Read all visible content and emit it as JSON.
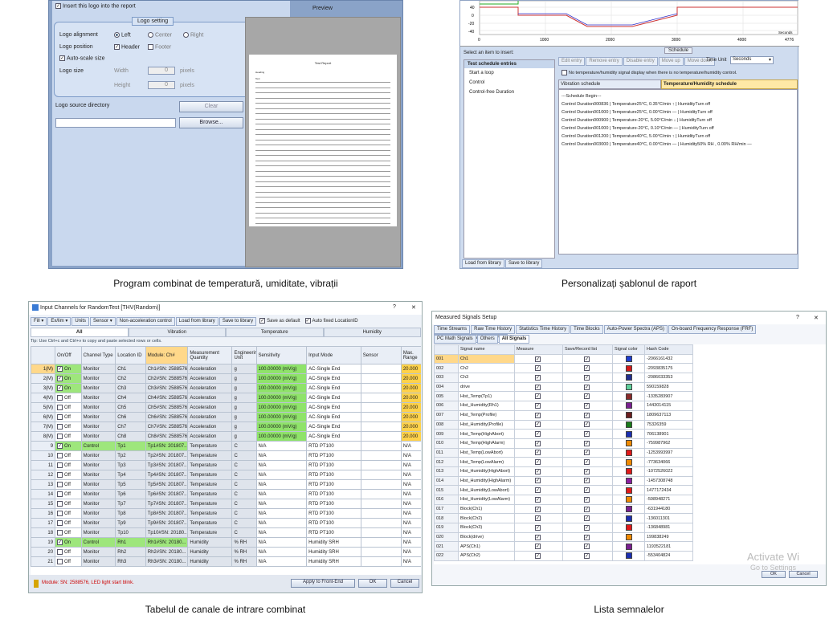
{
  "captions": {
    "p1": "Program combinat de temperatură, umiditate, vibrații",
    "p2": "Personalizați șablonul de raport",
    "p3": "Tabelul de canale de intrare combinat",
    "p4": "Lista semnalelor"
  },
  "logo": {
    "insert_label": "Insert this logo into the report",
    "preview_label": "Preview",
    "group_title": "Logo setting",
    "alignment_label": "Logo alignment",
    "align_left": "Left",
    "align_center": "Center",
    "align_right": "Right",
    "position_label": "Logo position",
    "pos_header": "Header",
    "pos_footer": "Footer",
    "autoscale_label": "Auto-scale size",
    "size_label": "Logo size",
    "width_label": "Width",
    "height_label": "Height",
    "width_value": "0",
    "height_value": "0",
    "pixels": "pixels",
    "source_label": "Logo source directory",
    "clear_btn": "Clear",
    "browse_btn": "Browse...",
    "doc_title": "Test Report",
    "doc_line1": "Heading",
    "doc_line2": "Text"
  },
  "schedule": {
    "y_ticks": [
      "40",
      "0",
      "-20",
      "-40"
    ],
    "x_ticks": [
      "0",
      "1000",
      "2000",
      "3000",
      "4000",
      "4776"
    ],
    "x_unit": "Seconds",
    "schedule_tab": "Schedule",
    "select_label": "Select an item to insert:",
    "list_header": "Test schedule entries",
    "list_items": [
      "Start a loop",
      "Control",
      "Control-free Duration"
    ],
    "toolbar": [
      "Edit entry",
      "Remove entry",
      "Disable entry",
      "Move up",
      "Move down"
    ],
    "time_unit_label": "Time Unit",
    "time_unit_value": "Seconds",
    "no_display_label": "No temperature/humidity signal display when there is no temperature/humidity control.",
    "tabs": [
      "Vibration schedule",
      "Temperature/Humidity schedule"
    ],
    "lines": [
      "---Schedule Begin---",
      "Control Duration000836 | Temperature25°C, 0.35°C/min ↑ | HumidityTurn off",
      "Control Duration001000 | Temperature25°C, 0.00°C/min — | HumidityTurn off",
      "Control Duration000900 | Temperature-20°C, 5.00°C/min ↓ | HumidityTurn off",
      "Control Duration001000 | Temperature-20°C, 0.10°C/min — | HumidityTurn off",
      "Control Duration001200 | Temperature40°C, 5.00°C/min ↑ | HumidityTurn off",
      "Control Duration003000 | Temperature40°C, 0.00°C/min — | Humidity50% RH , 0.00% RH/min —"
    ],
    "bottom_btns": [
      "Load from library",
      "Save to library"
    ]
  },
  "channels": {
    "title": "Input Channels for  RandomTest [THV(Random)]",
    "help": "?",
    "close": "✕",
    "toolbar": [
      "Fill ▾",
      "Ex/lim ▾",
      "Units",
      "Sensor ▾",
      "Non-acceleration control",
      "Load from library",
      "Save to library"
    ],
    "save_default": "Save as default",
    "auto_fixed": "Auto fixed LocationID",
    "tabs": [
      "All",
      "Vibration",
      "Temperature",
      "Humidity"
    ],
    "tip": "Tip: Use Ctrl+c and Ctrl+v to copy and paste selected rows or cells.",
    "headers": [
      "",
      "On/Off",
      "Channel Type",
      "Location ID",
      "Module: Ch#",
      "Measurement Quantity",
      "Engineering Unit",
      "Sensitivity",
      "Input Mode",
      "Sensor",
      "Max. Range"
    ],
    "rows": [
      [
        "1(M)",
        "On",
        "Monitor",
        "Ch1",
        "Ch1#SN: 2588576",
        "Acceleration",
        "g",
        "100.00000 (mV/g)",
        "AC-Single End",
        "",
        "20.000"
      ],
      [
        "2(M)",
        "On",
        "Monitor",
        "Ch2",
        "Ch2#SN: 2588576",
        "Acceleration",
        "g",
        "100.00000 (mV/g)",
        "AC-Single End",
        "",
        "20.000"
      ],
      [
        "3(M)",
        "On",
        "Monitor",
        "Ch3",
        "Ch3#SN: 2588576",
        "Acceleration",
        "g",
        "100.00000 (mV/g)",
        "AC-Single End",
        "",
        "20.000"
      ],
      [
        "4(M)",
        "Off",
        "Monitor",
        "Ch4",
        "Ch4#SN: 2588576",
        "Acceleration",
        "g",
        "100.00000 (mV/g)",
        "AC-Single End",
        "",
        "20.000"
      ],
      [
        "5(M)",
        "Off",
        "Monitor",
        "Ch5",
        "Ch5#SN: 2588576",
        "Acceleration",
        "g",
        "100.00000 (mV/g)",
        "AC-Single End",
        "",
        "20.000"
      ],
      [
        "6(M)",
        "Off",
        "Monitor",
        "Ch6",
        "Ch6#SN: 2588576",
        "Acceleration",
        "g",
        "100.00000 (mV/g)",
        "AC-Single End",
        "",
        "20.000"
      ],
      [
        "7(M)",
        "Off",
        "Monitor",
        "Ch7",
        "Ch7#SN: 2588576",
        "Acceleration",
        "g",
        "100.00000 (mV/g)",
        "AC-Single End",
        "",
        "20.000"
      ],
      [
        "8(M)",
        "Off",
        "Monitor",
        "Ch8",
        "Ch8#SN: 2588576",
        "Acceleration",
        "g",
        "100.00000 (mV/g)",
        "AC-Single End",
        "",
        "20.000"
      ],
      [
        "9",
        "On",
        "Control",
        "Tp1",
        "Tp1#SN: 201807...",
        "Temperature",
        "C",
        "N/A",
        "RTD PT100",
        "",
        "N/A"
      ],
      [
        "10",
        "Off",
        "Monitor",
        "Tp2",
        "Tp2#SN: 201807...",
        "Temperature",
        "C",
        "N/A",
        "RTD PT100",
        "",
        "N/A"
      ],
      [
        "11",
        "Off",
        "Monitor",
        "Tp3",
        "Tp3#SN: 201807...",
        "Temperature",
        "C",
        "N/A",
        "RTD PT100",
        "",
        "N/A"
      ],
      [
        "12",
        "Off",
        "Monitor",
        "Tp4",
        "Tp4#SN: 201807...",
        "Temperature",
        "C",
        "N/A",
        "RTD PT100",
        "",
        "N/A"
      ],
      [
        "13",
        "Off",
        "Monitor",
        "Tp5",
        "Tp5#SN: 201807...",
        "Temperature",
        "C",
        "N/A",
        "RTD PT100",
        "",
        "N/A"
      ],
      [
        "14",
        "Off",
        "Monitor",
        "Tp6",
        "Tp6#SN: 201807...",
        "Temperature",
        "C",
        "N/A",
        "RTD PT100",
        "",
        "N/A"
      ],
      [
        "15",
        "Off",
        "Monitor",
        "Tp7",
        "Tp7#SN: 201807...",
        "Temperature",
        "C",
        "N/A",
        "RTD PT100",
        "",
        "N/A"
      ],
      [
        "16",
        "Off",
        "Monitor",
        "Tp8",
        "Tp8#SN: 201807...",
        "Temperature",
        "C",
        "N/A",
        "RTD PT100",
        "",
        "N/A"
      ],
      [
        "17",
        "Off",
        "Monitor",
        "Tp9",
        "Tp9#SN: 201807...",
        "Temperature",
        "C",
        "N/A",
        "RTD PT100",
        "",
        "N/A"
      ],
      [
        "18",
        "Off",
        "Monitor",
        "Tp10",
        "Tp10#SN: 20180...",
        "Temperature",
        "C",
        "N/A",
        "RTD PT100",
        "",
        "N/A"
      ],
      [
        "19",
        "On",
        "Control",
        "Rh1",
        "Rh1#SN: 20180...",
        "Humidity",
        "% RH",
        "N/A",
        "Humidity SRH",
        "",
        "N/A"
      ],
      [
        "20",
        "Off",
        "Monitor",
        "Rh2",
        "Rh2#SN: 20180...",
        "Humidity",
        "% RH",
        "N/A",
        "Humidity SRH",
        "",
        "N/A"
      ],
      [
        "21",
        "Off",
        "Monitor",
        "Rh3",
        "Rh3#SN: 20180...",
        "Humidity",
        "% RH",
        "N/A",
        "Humidity SRH",
        "",
        "N/A"
      ]
    ],
    "status": "Module: SN: 2588576, LED light start blink.",
    "apply_btn": "Apply to Front-End",
    "ok_btn": "OK",
    "cancel_btn": "Cancel"
  },
  "signals": {
    "title": "Measured Signals Setup",
    "help": "?",
    "close": "✕",
    "tabs_row1": [
      "Time Streams",
      "Raw Time History",
      "Statistics Time History",
      "Time Blocks",
      "Auto-Power Spectra (APS)",
      "On-board Frequency Response (FRF)",
      "PC Frequency Response (FRF)"
    ],
    "tabs_row2": [
      "PC Math Signals",
      "Others",
      "All Signals"
    ],
    "headers": [
      "",
      "Signal name",
      "Measure",
      "Save/Record list",
      "Signal color",
      "Hash Code"
    ],
    "rows": [
      [
        "001",
        "Ch1",
        "#1f3fd0",
        "-2066161432"
      ],
      [
        "002",
        "Ch2",
        "#d21a1a",
        "-2093835175"
      ],
      [
        "003",
        "Ch3",
        "#23308f",
        "-2086033353"
      ],
      [
        "004",
        "drive",
        "#5fcf9b",
        "590159828"
      ],
      [
        "005",
        "Hist_Temp(Tp1)",
        "#8a2b2b",
        "-1335283907"
      ],
      [
        "006",
        "Hist_Humidity(Rh1)",
        "#7a2090",
        "1443014115"
      ],
      [
        "007",
        "Hist_Temp(Profile)",
        "#6b1f1f",
        "1809637113"
      ],
      [
        "008",
        "Hist_Humidity(Profile)",
        "#1a7a1a",
        "75326359"
      ],
      [
        "009",
        "Hist_Temp(HighAbort)",
        "#1c2fb0",
        "706138901"
      ],
      [
        "010",
        "Hist_Temp(HighAlarm)",
        "#f08a00",
        "-759987962"
      ],
      [
        "011",
        "Hist_Temp(LowAbort)",
        "#e01a1a",
        "-1253993997"
      ],
      [
        "012",
        "Hist_Temp(LowAlarm)",
        "#f08a00",
        "-773634066"
      ],
      [
        "013",
        "Hist_Humidity(HighAbort)",
        "#e01a1a",
        "-1072526022"
      ],
      [
        "014",
        "Hist_Humidity(HighAlarm)",
        "#8a1fa0",
        "-1457308748"
      ],
      [
        "015",
        "Hist_Humidity(LowAbort)",
        "#e01a1a",
        "1477172434"
      ],
      [
        "016",
        "Hist_Humidity(LowAlarm)",
        "#f08a00",
        "-598948271"
      ],
      [
        "017",
        "Block(Ch1)",
        "#7a2090",
        "-631944180"
      ],
      [
        "018",
        "Block(Ch2)",
        "#1c2fb0",
        "-136011301"
      ],
      [
        "019",
        "Block(Ch3)",
        "#e01a1a",
        "-136848981"
      ],
      [
        "020",
        "Block(drive)",
        "#f08a00",
        "199838249"
      ],
      [
        "021",
        "APS(Ch1)",
        "#7a2090",
        "1193522181"
      ],
      [
        "022",
        "APS(Ch2)",
        "#1c2fb0",
        "-553404824"
      ]
    ],
    "ok_btn": "OK",
    "cancel_btn": "Cancel",
    "watermark1": "Activate Wi",
    "watermark2": "Go to Settings"
  }
}
